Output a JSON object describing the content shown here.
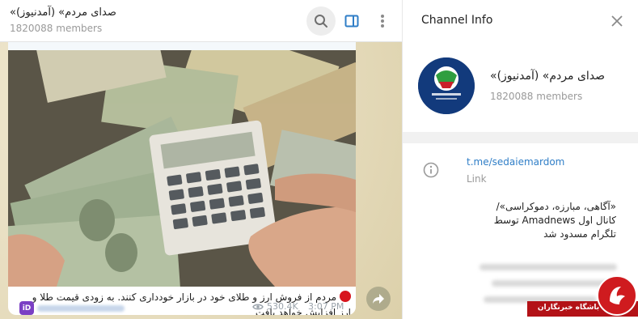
{
  "chat": {
    "title": "«صدای مردم» (آمدنیوز)",
    "members": "1820088 members",
    "header_icons": [
      "search-icon",
      "sidebar-toggle-icon",
      "more-vertical-icon"
    ]
  },
  "message": {
    "text": "مردم از فروش ارز و طلای خود در بازار خودداری کنند. به زودی قیمت طلا و ارز افزایش خواهد یافت",
    "id_badge": "iD",
    "views": "530.4K",
    "time": "3:07 PM"
  },
  "info": {
    "panel_title": "Channel Info",
    "channel_name": "«صدای مردم» (آمدنیوز)",
    "members": "1820088 members",
    "link": "t.me/sedaiemardom",
    "link_label": "Link",
    "description": "«آگاهی، مبارزه، دموکراسی»/ کانال اول Amadnews توسط تلگرام مسدود شد"
  },
  "watermark": {
    "text": "باشگاه خبرنگاران"
  },
  "colors": {
    "accent_blue": "#2f7ec7",
    "avatar_blue": "#123a7c",
    "watermark_red": "#b31217"
  }
}
